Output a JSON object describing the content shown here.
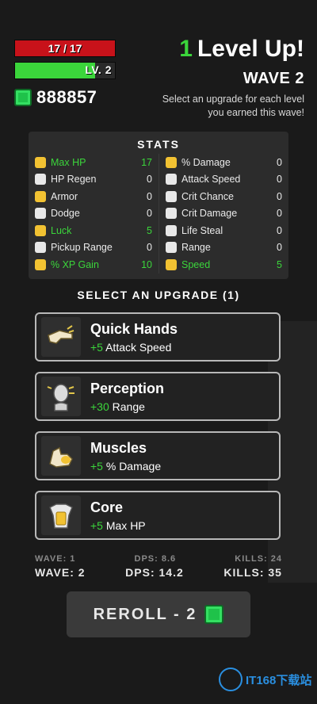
{
  "hud": {
    "hp_text": "17 / 17",
    "level_text": "LV. 2",
    "level_progress": 0.8,
    "currency_value": "888857"
  },
  "header": {
    "levelup_count": "1",
    "levelup_text": "Level Up!",
    "wave_text": "WAVE 2",
    "instruction": "Select an upgrade for each level you earned this wave!"
  },
  "stats": {
    "title": "STATS",
    "left": [
      {
        "label": "Max HP",
        "value": "17",
        "highlight": true,
        "icon": "armor-icon"
      },
      {
        "label": "HP Regen",
        "value": "0",
        "highlight": false,
        "icon": "regen-icon"
      },
      {
        "label": "Armor",
        "value": "0",
        "highlight": false,
        "icon": "armor-icon"
      },
      {
        "label": "Dodge",
        "value": "0",
        "highlight": false,
        "icon": "dodge-icon"
      },
      {
        "label": "Luck",
        "value": "5",
        "highlight": true,
        "icon": "luck-icon"
      },
      {
        "label": "Pickup Range",
        "value": "0",
        "highlight": false,
        "icon": "pickup-icon"
      },
      {
        "label": "% XP Gain",
        "value": "10",
        "highlight": true,
        "icon": "xp-icon"
      }
    ],
    "right": [
      {
        "label": "% Damage",
        "value": "0",
        "highlight": false,
        "icon": "muscle-icon"
      },
      {
        "label": "Attack Speed",
        "value": "0",
        "highlight": false,
        "icon": "hand-icon"
      },
      {
        "label": "Crit Chance",
        "value": "0",
        "highlight": false,
        "icon": "crit-icon"
      },
      {
        "label": "Crit Damage",
        "value": "0",
        "highlight": false,
        "icon": "crit-damage-icon"
      },
      {
        "label": "Life Steal",
        "value": "0",
        "highlight": false,
        "icon": "lifesteal-icon"
      },
      {
        "label": "Range",
        "value": "0",
        "highlight": false,
        "icon": "range-icon"
      },
      {
        "label": "Speed",
        "value": "5",
        "highlight": true,
        "icon": "speed-icon"
      }
    ]
  },
  "upgrade": {
    "heading": "SELECT AN UPGRADE (1)",
    "cards": [
      {
        "name": "Quick Hands",
        "bonus": "+5",
        "stat": "Attack Speed",
        "icon": "hand-icon"
      },
      {
        "name": "Perception",
        "bonus": "+30",
        "stat": "Range",
        "icon": "head-icon"
      },
      {
        "name": "Muscles",
        "bonus": "+5",
        "stat": "% Damage",
        "icon": "muscle-icon"
      },
      {
        "name": "Core",
        "bonus": "+5",
        "stat": "Max HP",
        "icon": "torso-icon"
      }
    ]
  },
  "summary": {
    "prev_wave": "WAVE: 1",
    "prev_dps": "DPS: 8.6",
    "prev_kills": "KILLS: 24",
    "wave": "WAVE: 2",
    "dps": "DPS: 14.2",
    "kills": "KILLS: 35"
  },
  "reroll": {
    "label": "REROLL - 2"
  },
  "watermark": {
    "text": "IT168下载站"
  },
  "colors": {
    "accent_green": "#3bd53b",
    "hp_red": "#c8121a",
    "gem_green": "#1fc24a"
  }
}
